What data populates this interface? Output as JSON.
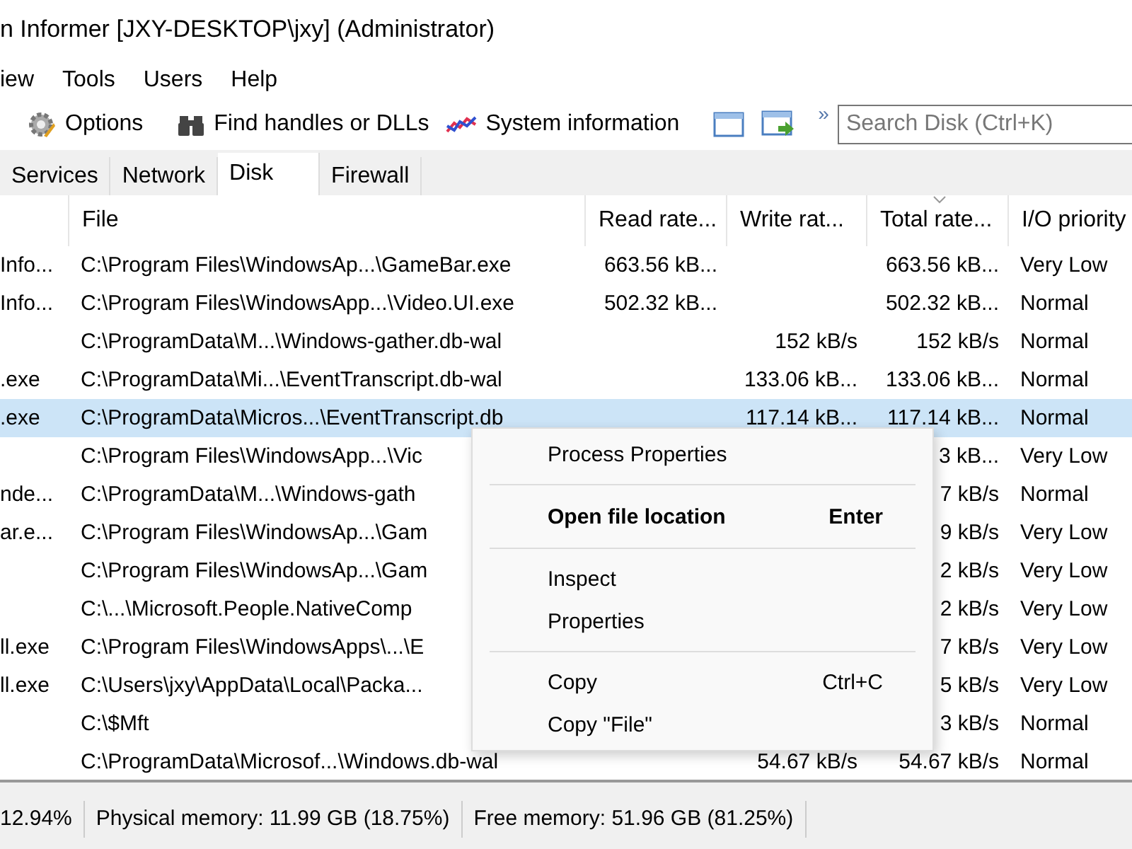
{
  "window": {
    "title": "n Informer [JXY-DESKTOP\\jxy] (Administrator)"
  },
  "menu_bar": [
    "iew",
    "Tools",
    "Users",
    "Help"
  ],
  "toolbar": {
    "buttons": [
      {
        "kind": "gear",
        "label": "Options"
      },
      {
        "kind": "binoculars",
        "label": "Find handles or DLLs"
      },
      {
        "kind": "chart",
        "label": "System information"
      }
    ],
    "icon_buttons": [
      {
        "kind": "window"
      },
      {
        "kind": "window-arrow"
      }
    ],
    "overflow": "»",
    "search": {
      "placeholder": "Search Disk (Ctrl+K)"
    }
  },
  "tabs": [
    {
      "label": "Services",
      "selected": false
    },
    {
      "label": "Network",
      "selected": false
    },
    {
      "label": "Disk",
      "selected": true
    },
    {
      "label": "Firewall",
      "selected": false
    }
  ],
  "table": {
    "columns": [
      {
        "sorted": false
      },
      {
        "label": "File",
        "sorted": false
      },
      {
        "label": "Read rate...",
        "sorted": false
      },
      {
        "label": "Write rat...",
        "sorted": false
      },
      {
        "label": "Total rate...",
        "sorted": true
      },
      {
        "label": "I/O priority",
        "sorted": false
      }
    ],
    "rows": [
      {
        "selected": false,
        "cells": [
          "Info...",
          "C:\\Program Files\\WindowsAp...\\GameBar.exe",
          "663.56 kB...",
          "",
          "663.56 kB...",
          "Very Low"
        ]
      },
      {
        "selected": false,
        "cells": [
          "Info...",
          "C:\\Program Files\\WindowsApp...\\Video.UI.exe",
          "502.32 kB...",
          "",
          "502.32 kB...",
          "Normal"
        ]
      },
      {
        "selected": false,
        "cells": [
          "",
          "C:\\ProgramData\\M...\\Windows-gather.db-wal",
          "",
          "152 kB/s",
          "152 kB/s",
          "Normal"
        ]
      },
      {
        "selected": false,
        "cells": [
          ".exe",
          "C:\\ProgramData\\Mi...\\EventTranscript.db-wal",
          "",
          "133.06 kB...",
          "133.06 kB...",
          "Normal"
        ]
      },
      {
        "selected": true,
        "cells": [
          ".exe",
          "C:\\ProgramData\\Micros...\\EventTranscript.db",
          "",
          "117.14 kB...",
          "117.14 kB...",
          "Normal"
        ]
      },
      {
        "selected": false,
        "cells": [
          "",
          "C:\\Program Files\\WindowsApp...\\Vic",
          "",
          "",
          "3 kB...",
          "Very Low"
        ]
      },
      {
        "selected": false,
        "cells": [
          "nde...",
          "C:\\ProgramData\\M...\\Windows-gath",
          "",
          "",
          "7 kB/s",
          "Normal"
        ]
      },
      {
        "selected": false,
        "cells": [
          "ar.e...",
          "C:\\Program Files\\WindowsAp...\\Gam",
          "",
          "",
          "9 kB/s",
          "Very Low"
        ]
      },
      {
        "selected": false,
        "cells": [
          "",
          "C:\\Program Files\\WindowsAp...\\Gam",
          "",
          "",
          "2 kB/s",
          "Very Low"
        ]
      },
      {
        "selected": false,
        "cells": [
          "",
          "C:\\...\\Microsoft.People.NativeComp",
          "",
          "",
          "2 kB/s",
          "Very Low"
        ]
      },
      {
        "selected": false,
        "cells": [
          "ll.exe",
          "C:\\Program Files\\WindowsApps\\...\\E",
          "",
          "",
          "7 kB/s",
          "Very Low"
        ]
      },
      {
        "selected": false,
        "cells": [
          "ll.exe",
          "C:\\Users\\jxy\\AppData\\Local\\Packa...",
          "",
          "",
          "5 kB/s",
          "Very Low"
        ]
      },
      {
        "selected": false,
        "cells": [
          "",
          "C:\\$Mft",
          "",
          "",
          "3 kB/s",
          "Normal"
        ]
      },
      {
        "selected": false,
        "cells": [
          "",
          "C:\\ProgramData\\Microsof...\\Windows.db-wal",
          "",
          "54.67 kB/s",
          "54.67 kB/s",
          "Normal"
        ]
      }
    ]
  },
  "context_menu": {
    "items": [
      {
        "kind": "item",
        "label": "Process Properties",
        "bold": false
      },
      {
        "kind": "separator"
      },
      {
        "kind": "item",
        "label": "Open file location",
        "shortcut": "Enter",
        "bold": true
      },
      {
        "kind": "separator"
      },
      {
        "kind": "item",
        "label": "Inspect",
        "bold": false
      },
      {
        "kind": "item",
        "label": "Properties",
        "bold": false
      },
      {
        "kind": "separator"
      },
      {
        "kind": "item",
        "label": "Copy",
        "shortcut": "Ctrl+C",
        "bold": false
      },
      {
        "kind": "item",
        "label": "Copy \"File\"",
        "bold": false
      }
    ]
  },
  "status_bar": [
    "12.94%",
    "Physical memory: 11.99 GB (18.75%)",
    "Free memory: 51.96 GB (81.25%)"
  ]
}
